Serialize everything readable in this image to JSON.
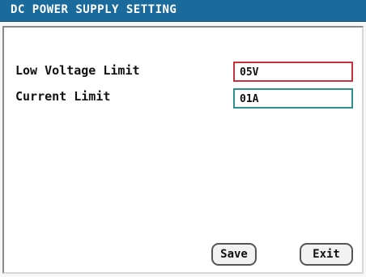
{
  "window": {
    "title": "DC POWER SUPPLY SETTING"
  },
  "fields": [
    {
      "label": "Low Voltage Limit",
      "value": "05V"
    },
    {
      "label": "Current Limit",
      "value": "01A"
    }
  ],
  "buttons": {
    "save_label": "Save",
    "exit_label": "Exit"
  },
  "colors": {
    "title_bar": "#1a6a9c",
    "focused_field_border": "#c8323e",
    "field_border": "#2f8f8c"
  }
}
